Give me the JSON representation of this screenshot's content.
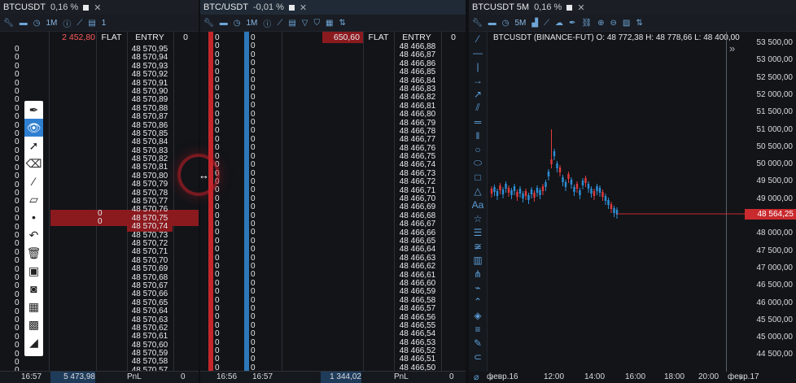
{
  "panels": {
    "dom1": {
      "tab_title": "BTCUSDT",
      "tab_pct": "0,16 %",
      "toolbar_interval": "1M",
      "toolbar_count": "1",
      "header": {
        "balance": "2 452,80",
        "flat": "FLAT",
        "entry": "ENTRY",
        "right": "0"
      },
      "prices": [
        "48 570,95",
        "48 570,94",
        "48 570,93",
        "48 570,92",
        "48 570,91",
        "48 570,90",
        "48 570,89",
        "48 570,88",
        "48 570,87",
        "48 570,86",
        "48 570,85",
        "48 570,84",
        "48 570,83",
        "48 570,82",
        "48 570,81",
        "48 570,80",
        "48 570,79",
        "48 570,78",
        "48 570,77",
        "48 570,76",
        "48 570,75",
        "48 570,74",
        "48 570,73",
        "48 570,72",
        "48 570,71",
        "48 570,70",
        "48 570,69",
        "48 570,68",
        "48 570,67",
        "48 570,66",
        "48 570,65",
        "48 570,64",
        "48 570,63",
        "48 570,62",
        "48 570,61",
        "48 570,60",
        "48 570,59",
        "48 570,58",
        "48 570,57"
      ],
      "highlight_value": "0",
      "footer": {
        "time": "16:57",
        "pnl_value": "5 473,98",
        "pnl_label": "PnL",
        "right": "0"
      }
    },
    "dom2": {
      "tab_title": "BTC/USDT",
      "tab_pct": "-0,01 %",
      "toolbar_interval": "1M",
      "header": {
        "balance": "650,60",
        "flat": "FLAT",
        "entry": "ENTRY",
        "right": "0"
      },
      "prices": [
        "48 466,88",
        "48 466,87",
        "48 466,86",
        "48 466,85",
        "48 466,84",
        "48 466,83",
        "48 466,82",
        "48 466,81",
        "48 466,80",
        "48 466,79",
        "48 466,78",
        "48 466,77",
        "48 466,76",
        "48 466,75",
        "48 466,74",
        "48 466,73",
        "48 466,72",
        "48 466,71",
        "48 466,70",
        "48 466,69",
        "48 466,68",
        "48 466,67",
        "48 466,66",
        "48 466,65",
        "48 466,64",
        "48 466,63",
        "48 466,62",
        "48 466,61",
        "48 466,60",
        "48 466,59",
        "48 466,58",
        "48 466,57",
        "48 466,56",
        "48 466,55",
        "48 466,54",
        "48 466,53",
        "48 466,52",
        "48 466,51",
        "48 466,50"
      ],
      "footer": {
        "time1": "16:56",
        "time2": "16:57",
        "pnl_value": "1 344,02",
        "pnl_label": "PnL",
        "right": "0"
      }
    },
    "chart": {
      "tab_title": "BTCUSDT 5M",
      "tab_pct": "0,16 %",
      "toolbar_interval": "5M",
      "legend": "BTCUSDT (BINANCE-FUT)  O: 48 772,38  H: 48 778,66  L: 48 400,00",
      "price_badge": "48 564,25",
      "y_ticks": [
        "53 500,00",
        "53 000,00",
        "52 500,00",
        "52 000,00",
        "51 500,00",
        "51 000,00",
        "50 500,00",
        "50 000,00",
        "49 500,00",
        "49 000,00",
        "48 500,00",
        "48 000,00",
        "47 500,00",
        "47 000,00",
        "46 500,00",
        "46 000,00",
        "45 500,00",
        "45 000,00",
        "44 500,00"
      ],
      "x_ticks": [
        "февр.16",
        "12:00",
        "14:00",
        "16:00",
        "18:00",
        "20:00",
        "февр.17"
      ]
    }
  },
  "colors": {
    "accent": "#2f7fd1",
    "sell": "#e03a3e",
    "buy": "#2d8fd6",
    "bg": "#121418"
  }
}
